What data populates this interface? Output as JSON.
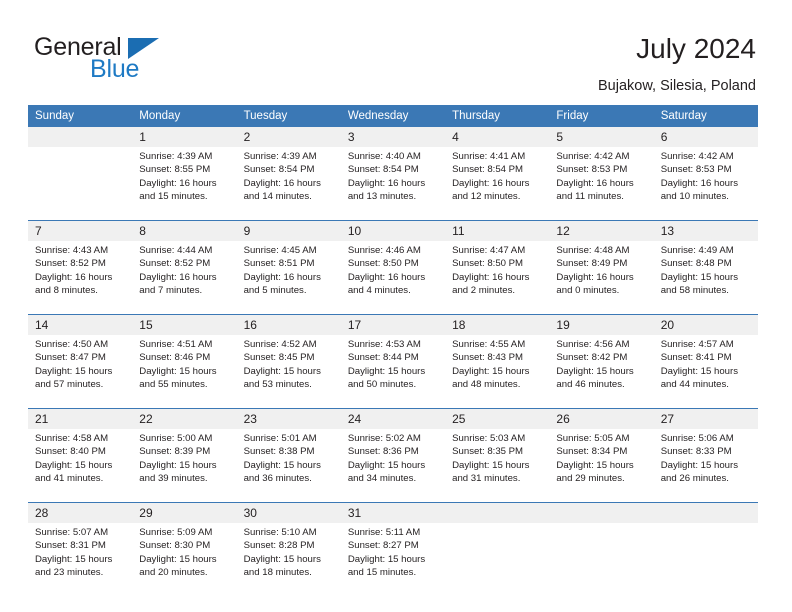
{
  "brand": {
    "name_part1": "General",
    "name_part2": "Blue"
  },
  "header": {
    "title": "July 2024",
    "location": "Bujakow, Silesia, Poland"
  },
  "colors": {
    "header_blue": "#3b78b5",
    "brand_blue": "#1e7ac4",
    "daynum_bg": "#f0f0f0",
    "text": "#231f20"
  },
  "weekdays": [
    "Sunday",
    "Monday",
    "Tuesday",
    "Wednesday",
    "Thursday",
    "Friday",
    "Saturday"
  ],
  "labels": {
    "sunrise_prefix": "Sunrise:",
    "sunset_prefix": "Sunset:",
    "daylight_prefix": "Daylight:"
  },
  "weeks": [
    {
      "days": [
        {
          "num": "",
          "line1": "",
          "line2": "",
          "line3": "",
          "line4": ""
        },
        {
          "num": "1",
          "line1": "Sunrise: 4:39 AM",
          "line2": "Sunset: 8:55 PM",
          "line3": "Daylight: 16 hours",
          "line4": "and 15 minutes."
        },
        {
          "num": "2",
          "line1": "Sunrise: 4:39 AM",
          "line2": "Sunset: 8:54 PM",
          "line3": "Daylight: 16 hours",
          "line4": "and 14 minutes."
        },
        {
          "num": "3",
          "line1": "Sunrise: 4:40 AM",
          "line2": "Sunset: 8:54 PM",
          "line3": "Daylight: 16 hours",
          "line4": "and 13 minutes."
        },
        {
          "num": "4",
          "line1": "Sunrise: 4:41 AM",
          "line2": "Sunset: 8:54 PM",
          "line3": "Daylight: 16 hours",
          "line4": "and 12 minutes."
        },
        {
          "num": "5",
          "line1": "Sunrise: 4:42 AM",
          "line2": "Sunset: 8:53 PM",
          "line3": "Daylight: 16 hours",
          "line4": "and 11 minutes."
        },
        {
          "num": "6",
          "line1": "Sunrise: 4:42 AM",
          "line2": "Sunset: 8:53 PM",
          "line3": "Daylight: 16 hours",
          "line4": "and 10 minutes."
        }
      ]
    },
    {
      "days": [
        {
          "num": "7",
          "line1": "Sunrise: 4:43 AM",
          "line2": "Sunset: 8:52 PM",
          "line3": "Daylight: 16 hours",
          "line4": "and 8 minutes."
        },
        {
          "num": "8",
          "line1": "Sunrise: 4:44 AM",
          "line2": "Sunset: 8:52 PM",
          "line3": "Daylight: 16 hours",
          "line4": "and 7 minutes."
        },
        {
          "num": "9",
          "line1": "Sunrise: 4:45 AM",
          "line2": "Sunset: 8:51 PM",
          "line3": "Daylight: 16 hours",
          "line4": "and 5 minutes."
        },
        {
          "num": "10",
          "line1": "Sunrise: 4:46 AM",
          "line2": "Sunset: 8:50 PM",
          "line3": "Daylight: 16 hours",
          "line4": "and 4 minutes."
        },
        {
          "num": "11",
          "line1": "Sunrise: 4:47 AM",
          "line2": "Sunset: 8:50 PM",
          "line3": "Daylight: 16 hours",
          "line4": "and 2 minutes."
        },
        {
          "num": "12",
          "line1": "Sunrise: 4:48 AM",
          "line2": "Sunset: 8:49 PM",
          "line3": "Daylight: 16 hours",
          "line4": "and 0 minutes."
        },
        {
          "num": "13",
          "line1": "Sunrise: 4:49 AM",
          "line2": "Sunset: 8:48 PM",
          "line3": "Daylight: 15 hours",
          "line4": "and 58 minutes."
        }
      ]
    },
    {
      "days": [
        {
          "num": "14",
          "line1": "Sunrise: 4:50 AM",
          "line2": "Sunset: 8:47 PM",
          "line3": "Daylight: 15 hours",
          "line4": "and 57 minutes."
        },
        {
          "num": "15",
          "line1": "Sunrise: 4:51 AM",
          "line2": "Sunset: 8:46 PM",
          "line3": "Daylight: 15 hours",
          "line4": "and 55 minutes."
        },
        {
          "num": "16",
          "line1": "Sunrise: 4:52 AM",
          "line2": "Sunset: 8:45 PM",
          "line3": "Daylight: 15 hours",
          "line4": "and 53 minutes."
        },
        {
          "num": "17",
          "line1": "Sunrise: 4:53 AM",
          "line2": "Sunset: 8:44 PM",
          "line3": "Daylight: 15 hours",
          "line4": "and 50 minutes."
        },
        {
          "num": "18",
          "line1": "Sunrise: 4:55 AM",
          "line2": "Sunset: 8:43 PM",
          "line3": "Daylight: 15 hours",
          "line4": "and 48 minutes."
        },
        {
          "num": "19",
          "line1": "Sunrise: 4:56 AM",
          "line2": "Sunset: 8:42 PM",
          "line3": "Daylight: 15 hours",
          "line4": "and 46 minutes."
        },
        {
          "num": "20",
          "line1": "Sunrise: 4:57 AM",
          "line2": "Sunset: 8:41 PM",
          "line3": "Daylight: 15 hours",
          "line4": "and 44 minutes."
        }
      ]
    },
    {
      "days": [
        {
          "num": "21",
          "line1": "Sunrise: 4:58 AM",
          "line2": "Sunset: 8:40 PM",
          "line3": "Daylight: 15 hours",
          "line4": "and 41 minutes."
        },
        {
          "num": "22",
          "line1": "Sunrise: 5:00 AM",
          "line2": "Sunset: 8:39 PM",
          "line3": "Daylight: 15 hours",
          "line4": "and 39 minutes."
        },
        {
          "num": "23",
          "line1": "Sunrise: 5:01 AM",
          "line2": "Sunset: 8:38 PM",
          "line3": "Daylight: 15 hours",
          "line4": "and 36 minutes."
        },
        {
          "num": "24",
          "line1": "Sunrise: 5:02 AM",
          "line2": "Sunset: 8:36 PM",
          "line3": "Daylight: 15 hours",
          "line4": "and 34 minutes."
        },
        {
          "num": "25",
          "line1": "Sunrise: 5:03 AM",
          "line2": "Sunset: 8:35 PM",
          "line3": "Daylight: 15 hours",
          "line4": "and 31 minutes."
        },
        {
          "num": "26",
          "line1": "Sunrise: 5:05 AM",
          "line2": "Sunset: 8:34 PM",
          "line3": "Daylight: 15 hours",
          "line4": "and 29 minutes."
        },
        {
          "num": "27",
          "line1": "Sunrise: 5:06 AM",
          "line2": "Sunset: 8:33 PM",
          "line3": "Daylight: 15 hours",
          "line4": "and 26 minutes."
        }
      ]
    },
    {
      "days": [
        {
          "num": "28",
          "line1": "Sunrise: 5:07 AM",
          "line2": "Sunset: 8:31 PM",
          "line3": "Daylight: 15 hours",
          "line4": "and 23 minutes."
        },
        {
          "num": "29",
          "line1": "Sunrise: 5:09 AM",
          "line2": "Sunset: 8:30 PM",
          "line3": "Daylight: 15 hours",
          "line4": "and 20 minutes."
        },
        {
          "num": "30",
          "line1": "Sunrise: 5:10 AM",
          "line2": "Sunset: 8:28 PM",
          "line3": "Daylight: 15 hours",
          "line4": "and 18 minutes."
        },
        {
          "num": "31",
          "line1": "Sunrise: 5:11 AM",
          "line2": "Sunset: 8:27 PM",
          "line3": "Daylight: 15 hours",
          "line4": "and 15 minutes."
        },
        {
          "num": "",
          "line1": "",
          "line2": "",
          "line3": "",
          "line4": ""
        },
        {
          "num": "",
          "line1": "",
          "line2": "",
          "line3": "",
          "line4": ""
        },
        {
          "num": "",
          "line1": "",
          "line2": "",
          "line3": "",
          "line4": ""
        }
      ]
    }
  ]
}
